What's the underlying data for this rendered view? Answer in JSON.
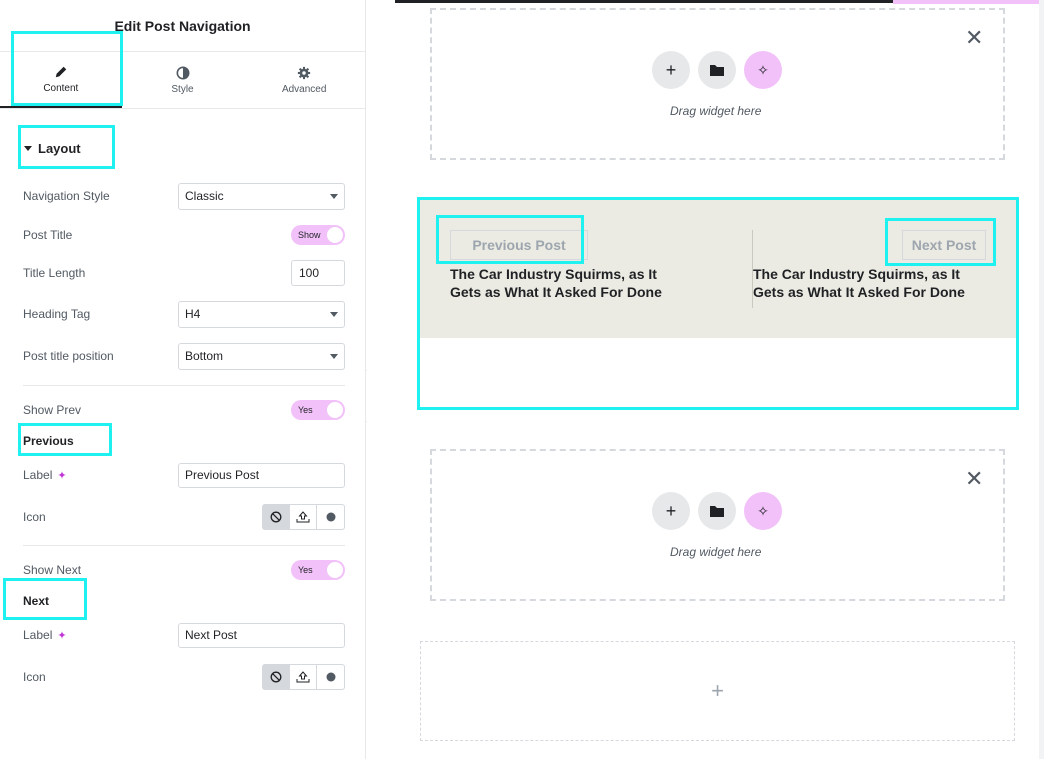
{
  "panel": {
    "title": "Edit Post Navigation",
    "tabs": [
      {
        "label": "Content",
        "icon": "pencil-icon"
      },
      {
        "label": "Style",
        "icon": "contrast-icon"
      },
      {
        "label": "Advanced",
        "icon": "gear-icon"
      }
    ],
    "section": "Layout",
    "fields": {
      "nav_style": {
        "label": "Navigation Style",
        "value": "Classic"
      },
      "post_title": {
        "label": "Post Title",
        "value": "Show"
      },
      "title_length": {
        "label": "Title Length",
        "value": "100"
      },
      "heading_tag": {
        "label": "Heading Tag",
        "value": "H4"
      },
      "title_position": {
        "label": "Post title position",
        "value": "Bottom"
      },
      "show_prev": {
        "label": "Show Prev",
        "value": "Yes"
      },
      "previous_head": "Previous",
      "prev_label": {
        "label": "Label",
        "value": "Previous Post"
      },
      "prev_icon": {
        "label": "Icon"
      },
      "show_next": {
        "label": "Show Next",
        "value": "Yes"
      },
      "next_head": "Next",
      "next_label": {
        "label": "Label",
        "value": "Next Post"
      },
      "next_icon": {
        "label": "Icon"
      }
    }
  },
  "canvas": {
    "drag_text": "Drag widget here",
    "prev_button": "Previous Post",
    "next_button": "Next Post",
    "prev_title": "The Car Industry Squirms, as It Gets as What It Asked For Done",
    "next_title": "The Car Industry Squirms, as It Gets as What It Asked For Done",
    "add_symbol": "+",
    "close_symbol": "✕"
  },
  "colors": {
    "highlight": "#1ff0f0",
    "ai_accent": "#f2c1f9",
    "nav_band": "#ebebe3"
  }
}
